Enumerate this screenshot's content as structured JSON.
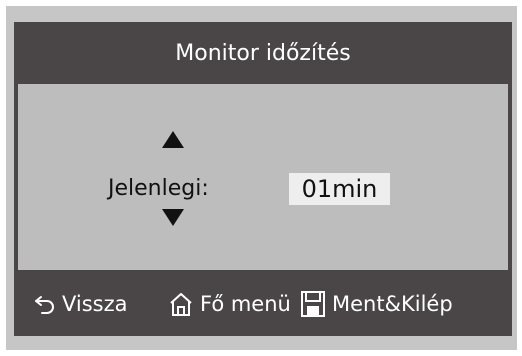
{
  "screen": {
    "title": "Monitor időzítés",
    "current_label": "Jelenlegi:",
    "current_value": "01min"
  },
  "footer": {
    "back_label": "Vissza",
    "home_label": "Fő menü",
    "save_label": "Ment&Kilép"
  },
  "icons": {
    "up": "arrow-up-icon",
    "down": "arrow-down-icon",
    "back": "return-arrow-icon",
    "home": "home-icon",
    "save": "floppy-disk-icon"
  },
  "colors": {
    "frame": "#4a4647",
    "content": "#bdbdbd",
    "value_highlight": "#eeeeee",
    "text_light": "#ffffff",
    "text_dark": "#111111"
  }
}
